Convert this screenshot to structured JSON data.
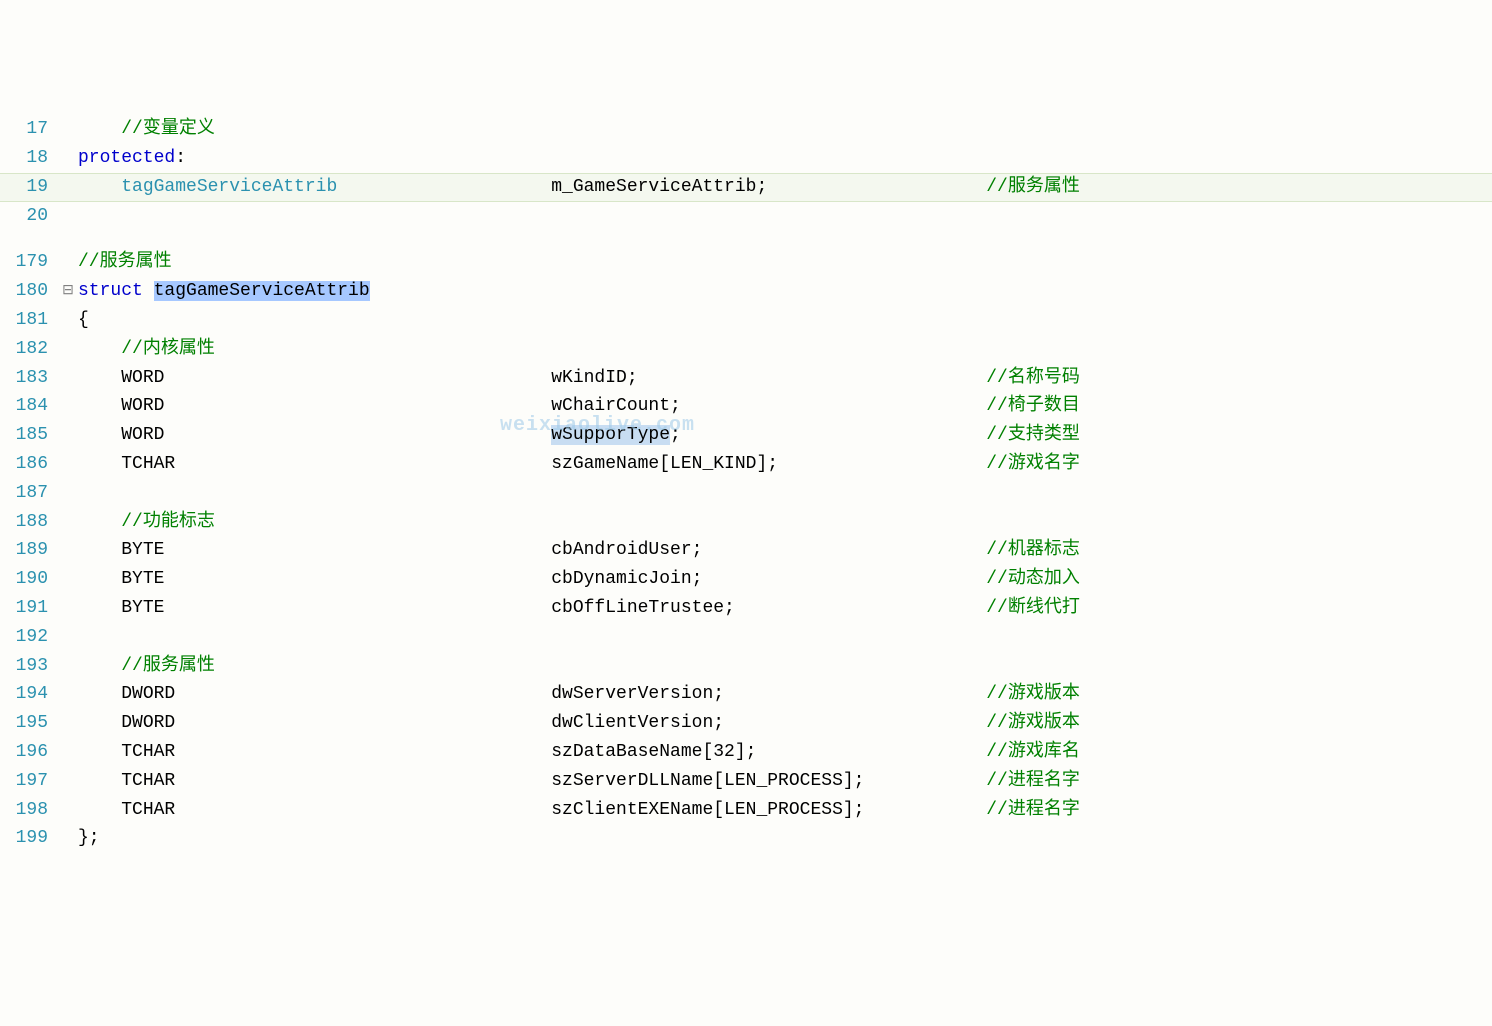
{
  "block1": {
    "lines": [
      {
        "num": "17",
        "fold": "",
        "html": "    <span class='comment'>//变量定义</span>"
      },
      {
        "num": "18",
        "fold": "",
        "html": "<span class='kw'>protected</span><span class='black'>:</span>"
      },
      {
        "num": "19",
        "fold": "",
        "hl": true,
        "html": "    <span class='col-type'><span class='ident'>tagGameServiceAttrib</span></span><span class='col-name'><span class='black'>m_GameServiceAttrib;</span></span><span class='comment'>//服务属性</span>"
      },
      {
        "num": "20",
        "fold": "",
        "html": ""
      }
    ]
  },
  "block2": {
    "lines": [
      {
        "num": "179",
        "fold": "",
        "html": "<span class='comment'>//服务属性</span>"
      },
      {
        "num": "180",
        "fold": "⊟",
        "html": "<span class='kw'>struct</span> <span class='selected'>tagGameServiceAttrib</span>"
      },
      {
        "num": "181",
        "fold": "",
        "html": "<span class='black'>{</span>"
      },
      {
        "num": "182",
        "fold": "",
        "html": "    <span class='comment'>//内核属性</span>"
      },
      {
        "num": "183",
        "fold": "",
        "html": "    <span class='col-type'><span class='black'>WORD</span></span><span class='col-name'><span class='black'>wKindID;</span></span><span class='comment'>//名称号码</span>"
      },
      {
        "num": "184",
        "fold": "",
        "html": "    <span class='col-type'><span class='black'>WORD</span></span><span class='col-name'><span class='black'>wChairCount;</span></span><span class='comment'>//椅子数目</span>"
      },
      {
        "num": "185",
        "fold": "",
        "html": "    <span class='col-type'><span class='black'>WORD</span></span><span class='col-name'><span class='black'><span class='sel2'>wSupporType</span>;</span></span><span class='comment'>//支持类型</span>"
      },
      {
        "num": "186",
        "fold": "",
        "html": "    <span class='col-type'><span class='black'>TCHAR</span></span><span class='col-name'><span class='black'>szGameName[LEN_KIND];</span></span><span class='comment'>//游戏名字</span>"
      },
      {
        "num": "187",
        "fold": "",
        "html": ""
      },
      {
        "num": "188",
        "fold": "",
        "html": "    <span class='comment'>//功能标志</span>"
      },
      {
        "num": "189",
        "fold": "",
        "html": "    <span class='col-type'><span class='black'>BYTE</span></span><span class='col-name'><span class='black'>cbAndroidUser;</span></span><span class='comment'>//机器标志</span>"
      },
      {
        "num": "190",
        "fold": "",
        "html": "    <span class='col-type'><span class='black'>BYTE</span></span><span class='col-name'><span class='black'>cbDynamicJoin;</span></span><span class='comment'>//动态加入</span>"
      },
      {
        "num": "191",
        "fold": "",
        "html": "    <span class='col-type'><span class='black'>BYTE</span></span><span class='col-name'><span class='black'>cbOffLineTrustee;</span></span><span class='comment'>//断线代打</span>"
      },
      {
        "num": "192",
        "fold": "",
        "html": ""
      },
      {
        "num": "193",
        "fold": "",
        "html": "    <span class='comment'>//服务属性</span>"
      },
      {
        "num": "194",
        "fold": "",
        "html": "    <span class='col-type'><span class='black'>DWORD</span></span><span class='col-name'><span class='black'>dwServerVersion;</span></span><span class='comment'>//游戏版本</span>"
      },
      {
        "num": "195",
        "fold": "",
        "html": "    <span class='col-type'><span class='black'>DWORD</span></span><span class='col-name'><span class='black'>dwClientVersion;</span></span><span class='comment'>//游戏版本</span>"
      },
      {
        "num": "196",
        "fold": "",
        "html": "    <span class='col-type'><span class='black'>TCHAR</span></span><span class='col-name'><span class='black'>szDataBaseName[32];</span></span><span class='comment'>//游戏库名</span>"
      },
      {
        "num": "197",
        "fold": "",
        "html": "    <span class='col-type'><span class='black'>TCHAR</span></span><span class='col-name'><span class='black'>szServerDLLName[LEN_PROCESS];</span></span><span class='comment'>//进程名字</span>"
      },
      {
        "num": "198",
        "fold": "",
        "html": "    <span class='col-type'><span class='black'>TCHAR</span></span><span class='col-name'><span class='black'>szClientEXEName[LEN_PROCESS];</span></span><span class='comment'>//进程名字</span>"
      },
      {
        "num": "199",
        "fold": "",
        "html": "<span class='black'>};</span>"
      }
    ]
  },
  "watermark": "weixiaolive.com"
}
